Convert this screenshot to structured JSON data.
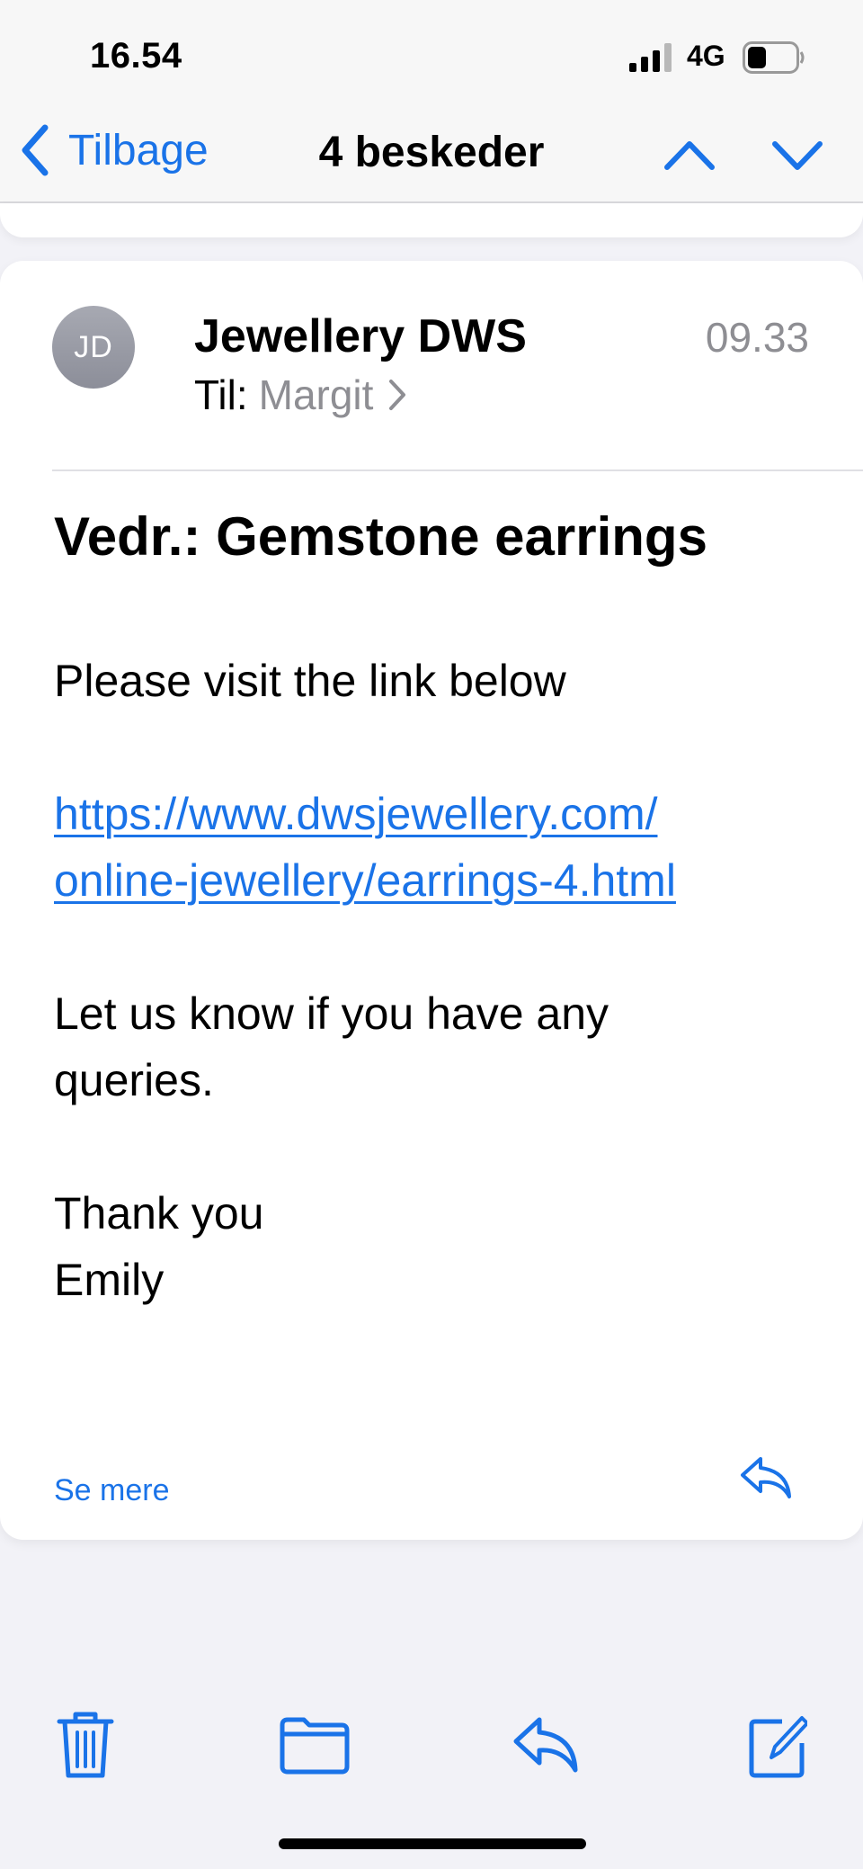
{
  "status_bar": {
    "time": "16.54",
    "network": "4G",
    "icons": [
      "signal-icon",
      "battery-icon"
    ]
  },
  "nav": {
    "back_label": "Tilbage",
    "title": "4 beskeder",
    "icons": [
      "chevron-left-icon",
      "chevron-up-icon",
      "chevron-down-icon"
    ]
  },
  "email": {
    "avatar_initials": "JD",
    "sender": "Jewellery DWS",
    "time": "09.33",
    "to_label": "Til:",
    "recipient": "Margit",
    "subject": "Vedr.: Gemstone earrings",
    "body": {
      "line1": "Please visit the link below",
      "link_line1": "https://www.dwsjewellery.com/",
      "link_line2": "online-jewellery/earrings-4.html",
      "query_line1": "Let us know if you have any",
      "query_line2": "queries.",
      "thanks": "Thank you",
      "signature": "Emily"
    },
    "see_more": "Se mere"
  },
  "toolbar": {
    "icons": [
      "trash-icon",
      "folder-icon",
      "reply-icon",
      "compose-icon"
    ]
  },
  "colors": {
    "accent": "#1a73e8",
    "secondary_text": "#8e8e93",
    "background": "#f2f2f7",
    "card": "#ffffff",
    "avatar": "#9a9ca6"
  }
}
